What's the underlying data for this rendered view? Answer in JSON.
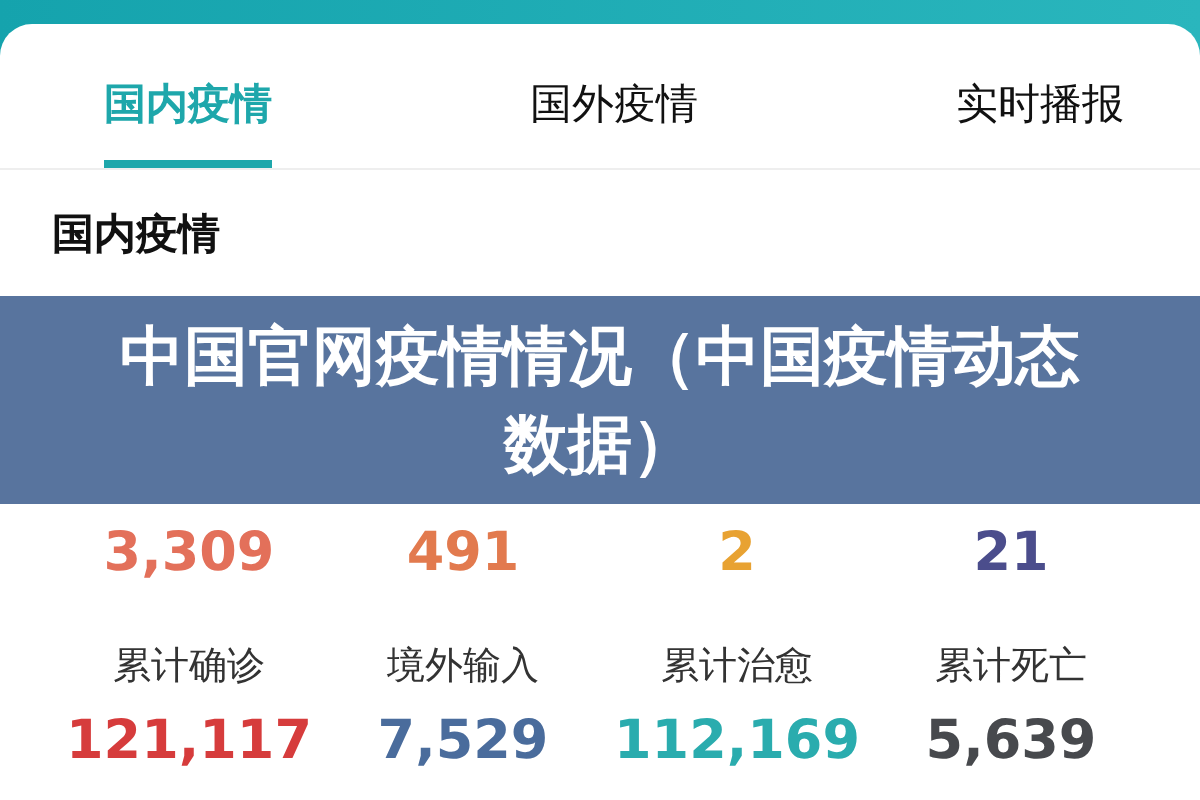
{
  "tabs": [
    {
      "label": "国内疫情",
      "selected": true
    },
    {
      "label": "国外疫情",
      "selected": false
    },
    {
      "label": "实时播报",
      "selected": false
    }
  ],
  "section": {
    "title": "国内疫情"
  },
  "stats": [
    {
      "value": "3,309",
      "color": "#e3705a"
    },
    {
      "value": "491",
      "color": "#e27a4e"
    },
    {
      "value": "2",
      "color": "#e8a232"
    },
    {
      "value": "21",
      "color": "#4b4d8c"
    },
    {
      "label": "累计确诊",
      "value": "121,117",
      "color": "#d63c3c"
    },
    {
      "label": "境外输入",
      "value": "7,529",
      "color": "#4a6c9c"
    },
    {
      "label": "累计治愈",
      "value": "112,169",
      "color": "#2aacae"
    },
    {
      "label": "累计死亡",
      "value": "5,639",
      "color": "#47494d"
    }
  ],
  "banner": {
    "title": "中国官网疫情情况（中国疫情动态数据）"
  }
}
